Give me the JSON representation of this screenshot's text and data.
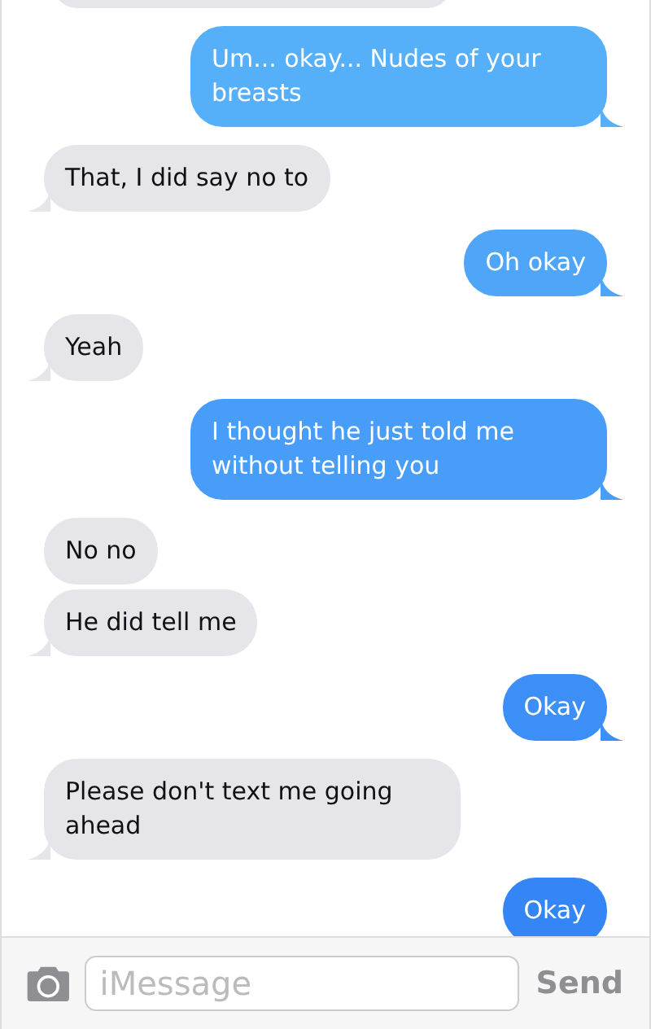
{
  "messages": [
    {
      "kind": "received-cut"
    },
    {
      "kind": "sent",
      "text": "Um... okay... Nudes of your breasts",
      "tail": true
    },
    {
      "kind": "received",
      "text": "That, I did say no to",
      "tail": true
    },
    {
      "kind": "sent",
      "text": "Oh okay",
      "tail": true
    },
    {
      "kind": "received",
      "text": "Yeah",
      "tail": true
    },
    {
      "kind": "sent",
      "text": "I thought he just told me without telling you",
      "tail": true
    },
    {
      "kind": "received",
      "text": "No no",
      "tail": false
    },
    {
      "kind": "received",
      "text": "He did tell me",
      "tail": true
    },
    {
      "kind": "sent",
      "text": "Okay",
      "tail": true
    },
    {
      "kind": "received",
      "text": "Please don't text me going ahead",
      "tail": true
    },
    {
      "kind": "sent",
      "text": "Okay",
      "tail": false
    }
  ],
  "composer": {
    "placeholder": "iMessage",
    "send": "Send"
  }
}
